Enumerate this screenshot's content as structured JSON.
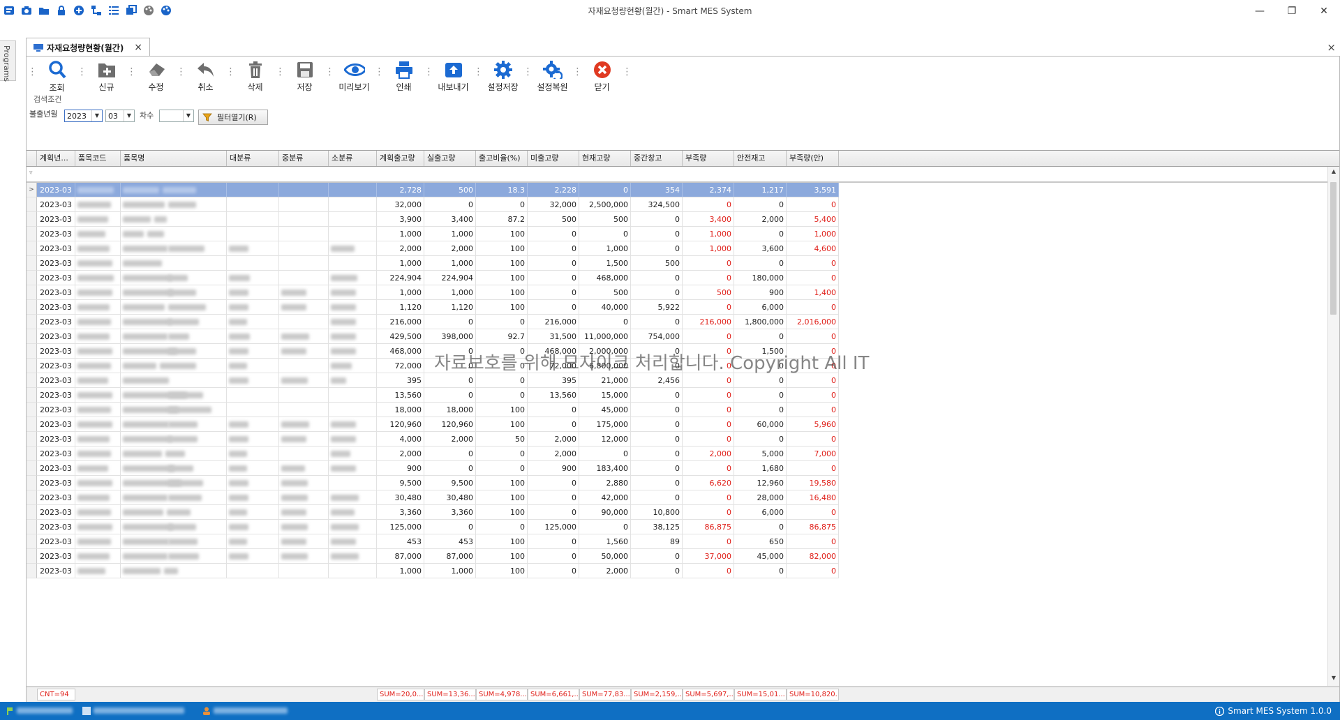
{
  "window": {
    "title": "자재요청량현황(월간) - Smart MES System",
    "controls": {
      "minimize": "—",
      "restore": "❐",
      "close": "✕"
    }
  },
  "side_tab": {
    "label": "Programs"
  },
  "document_tab": {
    "title": "자재요청량현황(월간)",
    "close": "×"
  },
  "app_close": "×",
  "toolbar": {
    "buttons": [
      {
        "label": "조회",
        "icon": "search-icon"
      },
      {
        "label": "신규",
        "icon": "new-folder-icon"
      },
      {
        "label": "수정",
        "icon": "eraser-icon"
      },
      {
        "label": "취소",
        "icon": "undo-icon"
      },
      {
        "label": "삭제",
        "icon": "trash-icon"
      },
      {
        "label": "저장",
        "icon": "save-icon"
      },
      {
        "label": "미리보기",
        "icon": "eye-icon"
      },
      {
        "label": "인쇄",
        "icon": "printer-icon"
      },
      {
        "label": "내보내기",
        "icon": "export-icon"
      },
      {
        "label": "설정저장",
        "icon": "gear-save-icon"
      },
      {
        "label": "설정복원",
        "icon": "gear-restore-icon"
      },
      {
        "label": "닫기",
        "icon": "close-circle-icon"
      }
    ]
  },
  "search": {
    "group_label": "검색조건",
    "year_month_label": "불출년월",
    "year_value": "2023",
    "month_value": "03",
    "seq_label": "차수",
    "seq_value": "",
    "filter_button": "필터열기(R)"
  },
  "grid": {
    "columns": [
      "계획년...",
      "품목코드",
      "품목명",
      "대분류",
      "중분류",
      "소분류",
      "계획출고량",
      "실출고량",
      "출고비율(%)",
      "미출고량",
      "현재고량",
      "중간창고",
      "부족량",
      "안전재고",
      "부족량(안)"
    ],
    "rows": [
      [
        "2023-03",
        "2,728",
        "500",
        "18.3",
        "2,228",
        "0",
        "354",
        "2,374",
        "1,217",
        "3,591"
      ],
      [
        "2023-03",
        "32,000",
        "0",
        "0",
        "32,000",
        "2,500,000",
        "324,500",
        "0",
        "0",
        "0"
      ],
      [
        "2023-03",
        "3,900",
        "3,400",
        "87.2",
        "500",
        "500",
        "0",
        "3,400",
        "2,000",
        "5,400"
      ],
      [
        "2023-03",
        "1,000",
        "1,000",
        "100",
        "0",
        "0",
        "0",
        "1,000",
        "0",
        "1,000"
      ],
      [
        "2023-03",
        "2,000",
        "2,000",
        "100",
        "0",
        "1,000",
        "0",
        "1,000",
        "3,600",
        "4,600"
      ],
      [
        "2023-03",
        "1,000",
        "1,000",
        "100",
        "0",
        "1,500",
        "500",
        "0",
        "0",
        "0"
      ],
      [
        "2023-03",
        "224,904",
        "224,904",
        "100",
        "0",
        "468,000",
        "0",
        "0",
        "180,000",
        "0"
      ],
      [
        "2023-03",
        "1,000",
        "1,000",
        "100",
        "0",
        "500",
        "0",
        "500",
        "900",
        "1,400"
      ],
      [
        "2023-03",
        "1,120",
        "1,120",
        "100",
        "0",
        "40,000",
        "5,922",
        "0",
        "6,000",
        "0"
      ],
      [
        "2023-03",
        "216,000",
        "0",
        "0",
        "216,000",
        "0",
        "0",
        "216,000",
        "1,800,000",
        "2,016,000"
      ],
      [
        "2023-03",
        "429,500",
        "398,000",
        "92.7",
        "31,500",
        "11,000,000",
        "754,000",
        "0",
        "0",
        "0"
      ],
      [
        "2023-03",
        "468,000",
        "0",
        "0",
        "468,000",
        "2,000,000",
        "0",
        "0",
        "1,500",
        "0"
      ],
      [
        "2023-03",
        "72,000",
        "0",
        "0",
        "72,000",
        "6,800,000",
        "0",
        "0",
        "0",
        "0"
      ],
      [
        "2023-03",
        "395",
        "0",
        "0",
        "395",
        "21,000",
        "2,456",
        "0",
        "0",
        "0"
      ],
      [
        "2023-03",
        "13,560",
        "0",
        "0",
        "13,560",
        "15,000",
        "0",
        "0",
        "0",
        "0"
      ],
      [
        "2023-03",
        "18,000",
        "18,000",
        "100",
        "0",
        "45,000",
        "0",
        "0",
        "0",
        "0"
      ],
      [
        "2023-03",
        "120,960",
        "120,960",
        "100",
        "0",
        "175,000",
        "0",
        "0",
        "60,000",
        "5,960"
      ],
      [
        "2023-03",
        "4,000",
        "2,000",
        "50",
        "2,000",
        "12,000",
        "0",
        "0",
        "0",
        "0"
      ],
      [
        "2023-03",
        "2,000",
        "0",
        "0",
        "2,000",
        "0",
        "0",
        "2,000",
        "5,000",
        "7,000"
      ],
      [
        "2023-03",
        "900",
        "0",
        "0",
        "900",
        "183,400",
        "0",
        "0",
        "1,680",
        "0"
      ],
      [
        "2023-03",
        "9,500",
        "9,500",
        "100",
        "0",
        "2,880",
        "0",
        "6,620",
        "12,960",
        "19,580"
      ],
      [
        "2023-03",
        "30,480",
        "30,480",
        "100",
        "0",
        "42,000",
        "0",
        "0",
        "28,000",
        "16,480"
      ],
      [
        "2023-03",
        "3,360",
        "3,360",
        "100",
        "0",
        "90,000",
        "10,800",
        "0",
        "6,000",
        "0"
      ],
      [
        "2023-03",
        "125,000",
        "0",
        "0",
        "125,000",
        "0",
        "38,125",
        "86,875",
        "0",
        "86,875"
      ],
      [
        "2023-03",
        "453",
        "453",
        "100",
        "0",
        "1,560",
        "89",
        "0",
        "650",
        "0"
      ],
      [
        "2023-03",
        "87,000",
        "87,000",
        "100",
        "0",
        "50,000",
        "0",
        "37,000",
        "45,000",
        "82,000"
      ],
      [
        "2023-03",
        "1,000",
        "1,000",
        "100",
        "0",
        "2,000",
        "0",
        "0",
        "0",
        "0"
      ]
    ],
    "footer": {
      "count": "CNT=94",
      "sums": [
        "SUM=20,0...",
        "SUM=13,36...",
        "SUM=4,978...",
        "SUM=6,661,...",
        "SUM=77,83...",
        "SUM=2,159,...",
        "SUM=5,697,...",
        "SUM=15,01...",
        "SUM=10,820..."
      ]
    }
  },
  "watermark": "자료보호를 위해 모자이크 처리합니다. Copyright All IT",
  "status_bar": {
    "app_version": "Smart MES System 1.0.0"
  },
  "colors": {
    "accent": "#0f6fc3",
    "selected_row": "#8ca9dc",
    "negative_text": "#e0201a"
  }
}
